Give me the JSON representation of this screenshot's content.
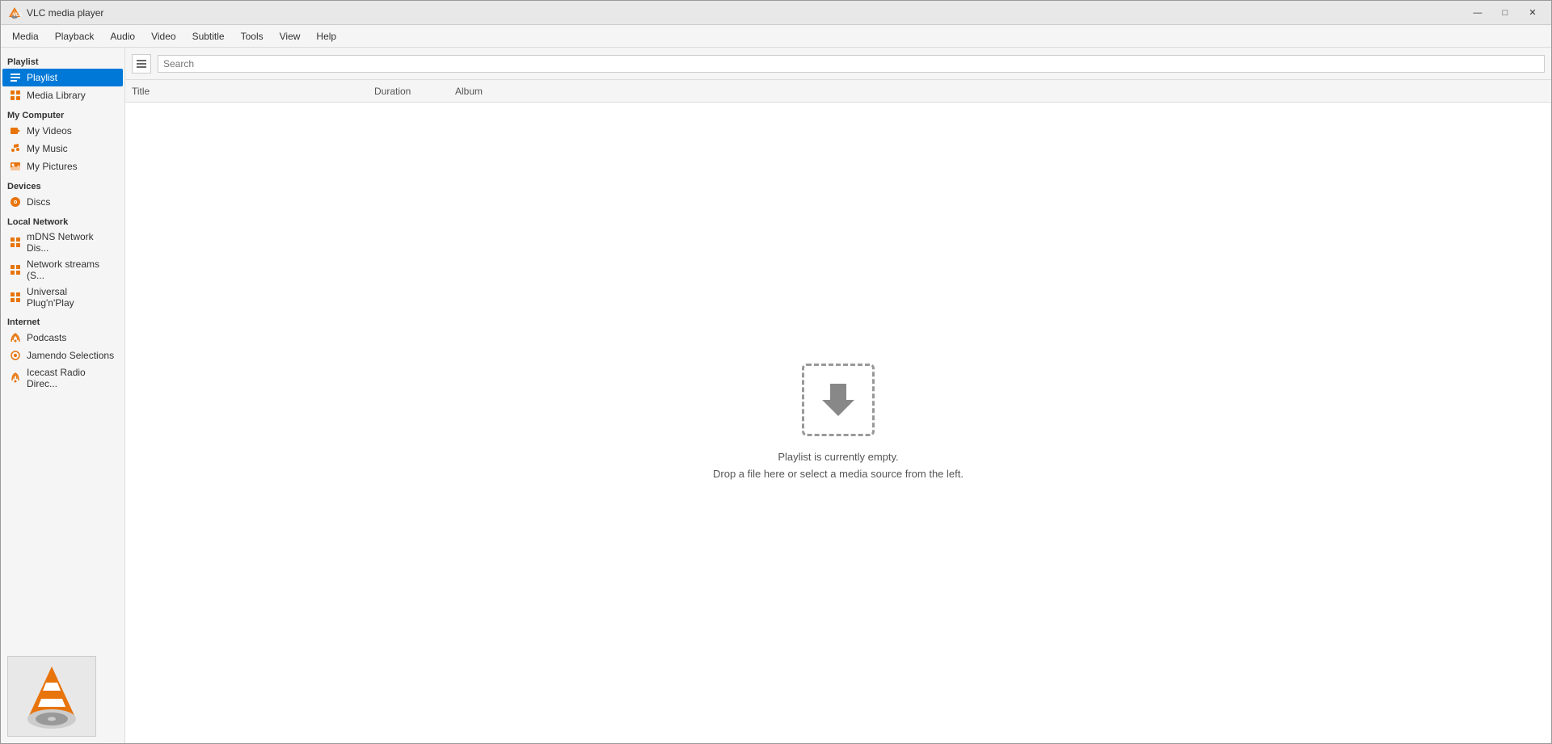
{
  "window": {
    "title": "VLC media player",
    "minimize_label": "—",
    "maximize_label": "□",
    "close_label": "✕"
  },
  "menu": {
    "items": [
      "Media",
      "Playback",
      "Audio",
      "Video",
      "Subtitle",
      "Tools",
      "View",
      "Help"
    ]
  },
  "sidebar": {
    "playlist_section": "Playlist",
    "playlist_item": "Playlist",
    "media_library_item": "Media Library",
    "my_computer_section": "My Computer",
    "my_videos_item": "My Videos",
    "my_music_item": "My Music",
    "my_pictures_item": "My Pictures",
    "devices_section": "Devices",
    "discs_item": "Discs",
    "local_network_section": "Local Network",
    "mdns_item": "mDNS Network Dis...",
    "network_streams_item": "Network streams (S...",
    "upnp_item": "Universal Plug'n'Play",
    "internet_section": "Internet",
    "podcasts_item": "Podcasts",
    "jamendo_item": "Jamendo Selections",
    "icecast_item": "Icecast Radio Direc..."
  },
  "columns": {
    "title": "Title",
    "duration": "Duration",
    "album": "Album"
  },
  "playlist": {
    "empty_line1": "Playlist is currently empty.",
    "empty_line2": "Drop a file here or select a media source from the left."
  },
  "toolbar": {
    "search_placeholder": "Search"
  },
  "colors": {
    "accent": "#0078d7",
    "vlc_orange": "#e8740c",
    "sidebar_bg": "#f5f5f5",
    "active_bg": "#0078d7"
  }
}
